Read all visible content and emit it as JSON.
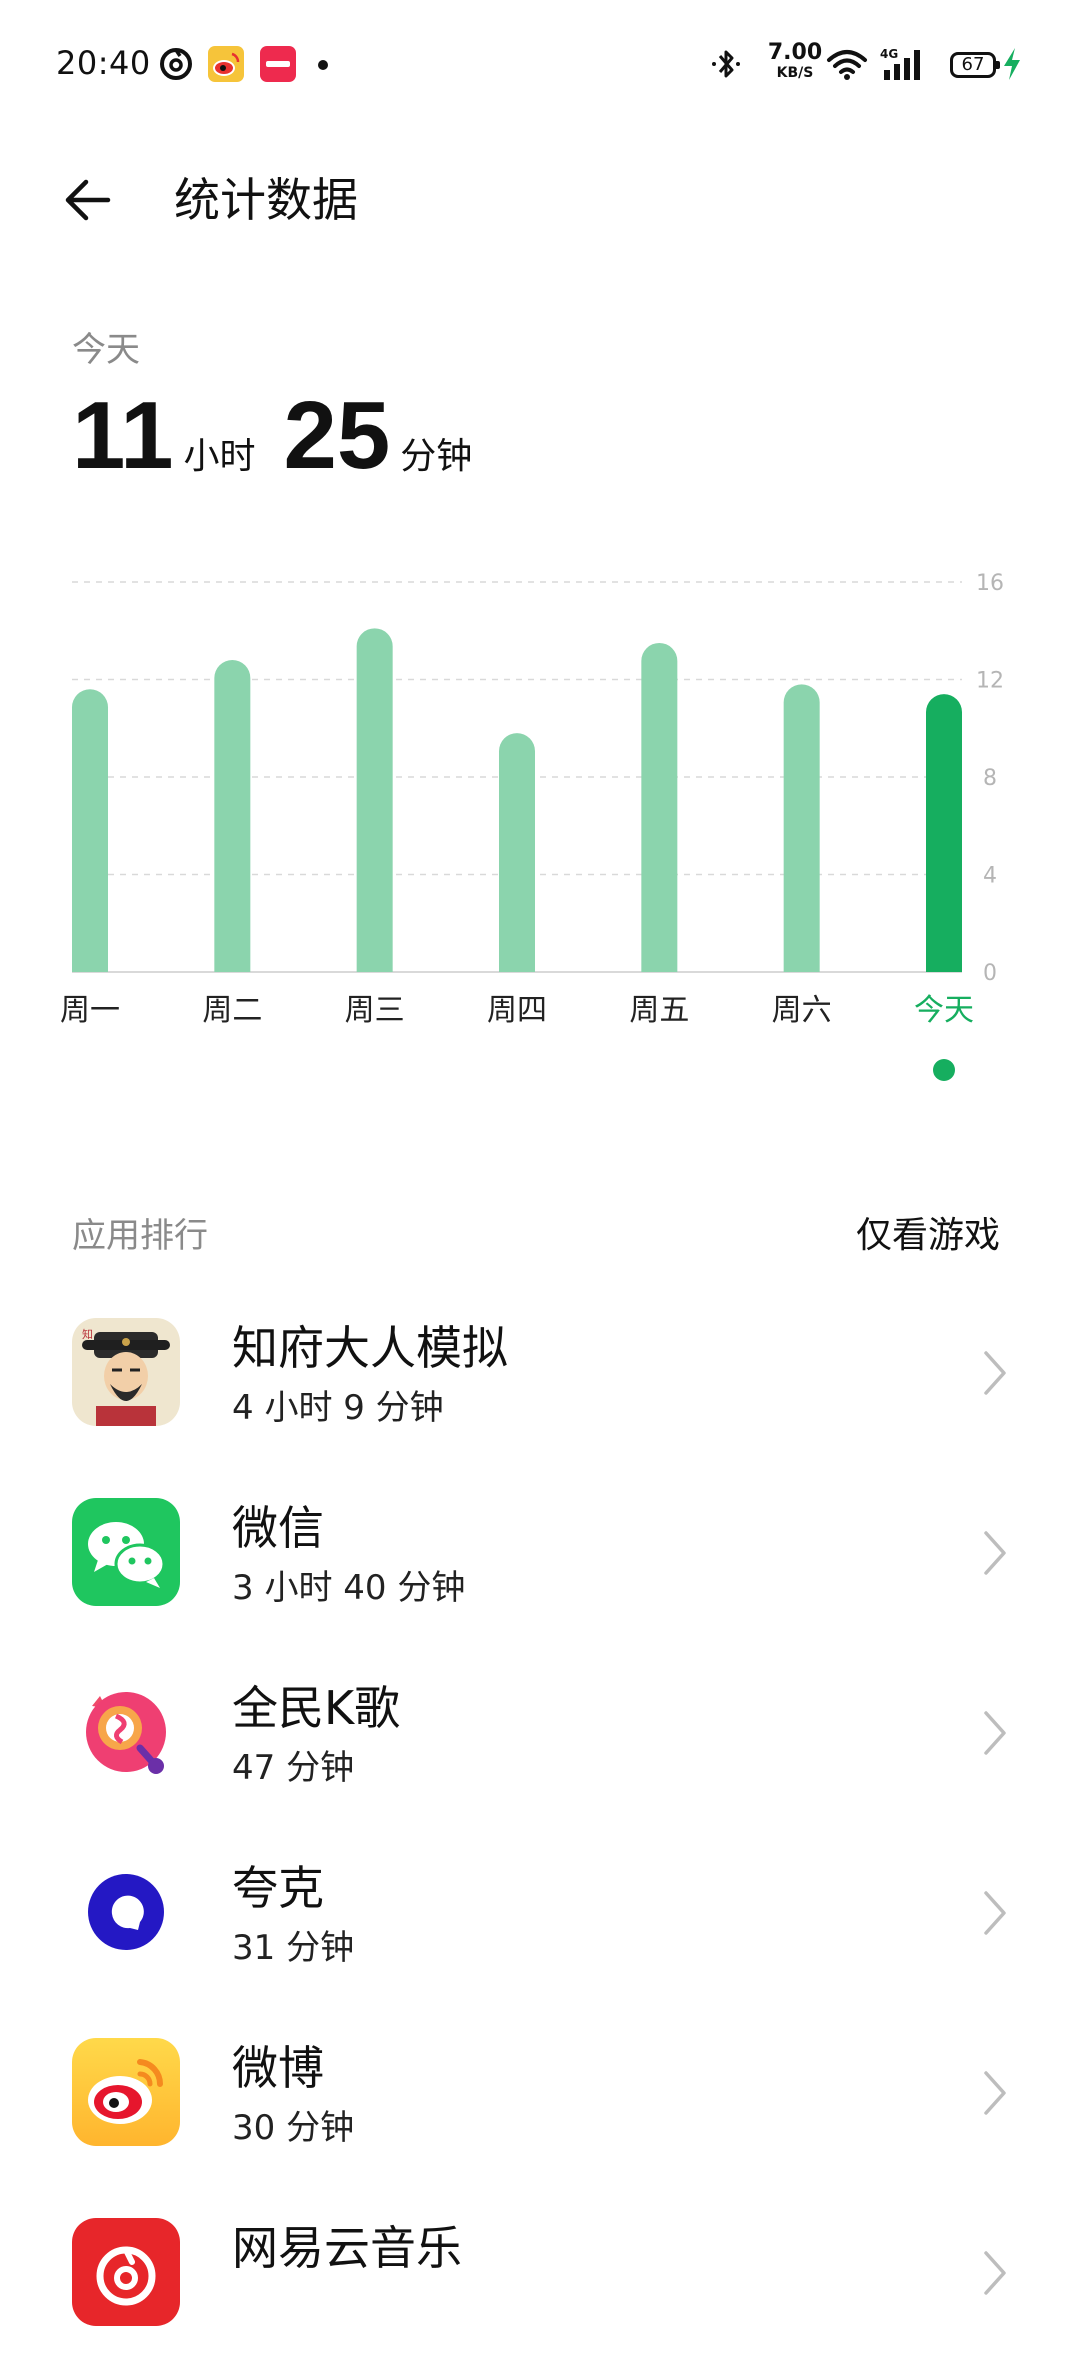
{
  "status_bar": {
    "time": "20:40",
    "net_speed_value": "7.00",
    "net_speed_unit": "KB/S",
    "battery": "67",
    "notification_icons": [
      "netease-icon",
      "weibo-icon",
      "xiaohongshu-icon"
    ],
    "system_icons": [
      "bluetooth-icon",
      "wifi-icon",
      "signal-4g-icon",
      "charging-icon"
    ]
  },
  "header": {
    "title": "统计数据"
  },
  "summary": {
    "period": "今天",
    "hours": "11",
    "hours_unit": "小时",
    "minutes": "25",
    "minutes_unit": "分钟"
  },
  "chart_data": {
    "type": "bar",
    "categories": [
      "周一",
      "周二",
      "周三",
      "周四",
      "周五",
      "周六",
      "今天"
    ],
    "values": [
      11.6,
      12.8,
      14.1,
      9.8,
      13.5,
      11.8,
      11.4
    ],
    "ylim": [
      0,
      16
    ],
    "yticks": [
      0,
      4,
      8,
      12,
      16
    ],
    "ytick_labels": [
      "0",
      "4",
      "8",
      "12",
      "16"
    ],
    "highlight_index": 6,
    "grid": true,
    "colors": {
      "bar": "#8bd4ad",
      "highlight_bar": "#16ae5f",
      "highlight_label": "#16ae5f",
      "grid": "#d9d9d9",
      "tick_label": "#b5b5b5"
    }
  },
  "ranking": {
    "title": "应用排行",
    "filter_label": "仅看游戏",
    "apps": [
      {
        "name": "知府大人模拟",
        "time": "4 小时 9 分钟",
        "icon": "zhifu-game-icon"
      },
      {
        "name": "微信",
        "time": "3 小时 40 分钟",
        "icon": "wechat-icon"
      },
      {
        "name": "全民K歌",
        "time": "47 分钟",
        "icon": "quanmin-kge-icon"
      },
      {
        "name": "夸克",
        "time": "31 分钟",
        "icon": "quark-icon"
      },
      {
        "name": "微博",
        "time": "30 分钟",
        "icon": "weibo-icon"
      },
      {
        "name": "网易云音乐",
        "time": "",
        "icon": "netease-music-icon"
      }
    ]
  }
}
